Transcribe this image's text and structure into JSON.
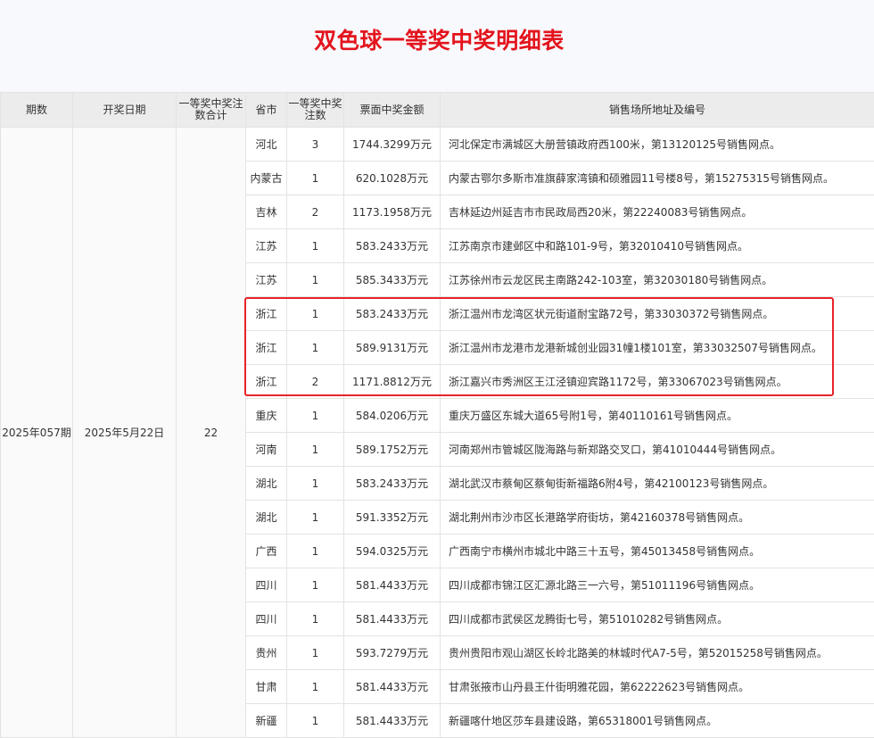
{
  "title": "双色球一等奖中奖明细表",
  "headers": [
    "期数",
    "开奖日期",
    "一等奖中奖注数合计",
    "省市",
    "一等奖中奖注数",
    "票面中奖金额",
    "销售场所地址及编号"
  ],
  "draw": {
    "period": "2025年057期",
    "date": "2025年5月22日",
    "total": "22"
  },
  "rows": [
    {
      "province": "河北",
      "count": "3",
      "amount": "1744.3299万元",
      "address": "河北保定市满城区大册营镇政府西100米，第13120125号销售网点。"
    },
    {
      "province": "内蒙古",
      "count": "1",
      "amount": "620.1028万元",
      "address": "内蒙古鄂尔多斯市准旗薛家湾镇和硕雅园11号楼8号，第15275315号销售网点。"
    },
    {
      "province": "吉林",
      "count": "2",
      "amount": "1173.1958万元",
      "address": "吉林延边州延吉市市民政局西20米，第22240083号销售网点。"
    },
    {
      "province": "江苏",
      "count": "1",
      "amount": "583.2433万元",
      "address": "江苏南京市建邺区中和路101-9号，第32010410号销售网点。"
    },
    {
      "province": "江苏",
      "count": "1",
      "amount": "585.3433万元",
      "address": "江苏徐州市云龙区民主南路242-103室，第32030180号销售网点。"
    },
    {
      "province": "浙江",
      "count": "1",
      "amount": "583.2433万元",
      "address": "浙江温州市龙湾区状元街道耐宝路72号，第33030372号销售网点。"
    },
    {
      "province": "浙江",
      "count": "1",
      "amount": "589.9131万元",
      "address": "浙江温州市龙港市龙港新城创业园31幢1楼101室，第33032507号销售网点。"
    },
    {
      "province": "浙江",
      "count": "2",
      "amount": "1171.8812万元",
      "address": "浙江嘉兴市秀洲区王江泾镇迎宾路1172号，第33067023号销售网点。"
    },
    {
      "province": "重庆",
      "count": "1",
      "amount": "584.0206万元",
      "address": "重庆万盛区东城大道65号附1号，第40110161号销售网点。"
    },
    {
      "province": "河南",
      "count": "1",
      "amount": "589.1752万元",
      "address": "河南郑州市管城区陇海路与新郑路交叉口，第41010444号销售网点。"
    },
    {
      "province": "湖北",
      "count": "1",
      "amount": "583.2433万元",
      "address": "湖北武汉市蔡甸区蔡甸街新福路6附4号，第42100123号销售网点。"
    },
    {
      "province": "湖北",
      "count": "1",
      "amount": "591.3352万元",
      "address": "湖北荆州市沙市区长港路学府街坊，第42160378号销售网点。"
    },
    {
      "province": "广西",
      "count": "1",
      "amount": "594.0325万元",
      "address": "广西南宁市横州市城北中路三十五号，第45013458号销售网点。"
    },
    {
      "province": "四川",
      "count": "1",
      "amount": "581.4433万元",
      "address": "四川成都市锦江区汇源北路三一六号，第51011196号销售网点。"
    },
    {
      "province": "四川",
      "count": "1",
      "amount": "581.4433万元",
      "address": "四川成都市武侯区龙腾街七号，第51010282号销售网点。"
    },
    {
      "province": "贵州",
      "count": "1",
      "amount": "593.7279万元",
      "address": "贵州贵阳市观山湖区长岭北路美的林城时代A7-5号，第52015258号销售网点。"
    },
    {
      "province": "甘肃",
      "count": "1",
      "amount": "581.4433万元",
      "address": "甘肃张掖市山丹县王什街明雅花园，第62222623号销售网点。"
    },
    {
      "province": "新疆",
      "count": "1",
      "amount": "581.4433万元",
      "address": "新疆喀什地区莎车县建设路，第65318001号销售网点。"
    }
  ],
  "colors": {
    "title": "#e3141d",
    "highlight": "#e8232a",
    "header_bg": "#ececec"
  }
}
